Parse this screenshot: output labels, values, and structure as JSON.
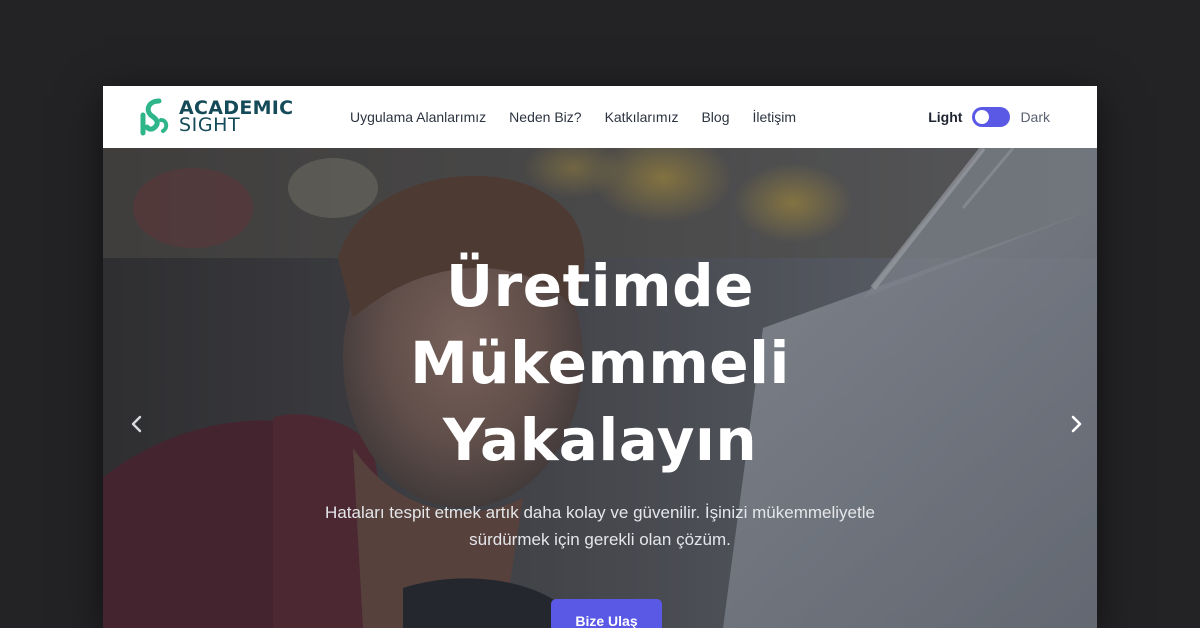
{
  "brand": {
    "name_line1": "ACADEMIC",
    "name_line2": "SIGHT",
    "color": "#154b58",
    "accent": "#2fb58a"
  },
  "nav": {
    "items": [
      {
        "label": "Uygulama Alanlarımız"
      },
      {
        "label": "Neden Biz?"
      },
      {
        "label": "Katkılarımız"
      },
      {
        "label": "Blog"
      },
      {
        "label": "İletişim"
      }
    ]
  },
  "theme_toggle": {
    "light_label": "Light",
    "dark_label": "Dark",
    "state": "light",
    "track_color": "#5a59e6"
  },
  "hero": {
    "title_lines": [
      "Üretimde",
      "Mükemmeli",
      "Yakalayın"
    ],
    "subtitle_lines": [
      "Hataları tespit etmek artık daha kolay ve güvenilir. İşinizi mükemmeliyetle",
      "sürdürmek için gerekli olan çözüm."
    ],
    "cta_label": "Bize Ulaş",
    "cta_color": "#5a59e6",
    "prev_icon": "chevron-left-icon",
    "next_icon": "chevron-right-icon"
  }
}
